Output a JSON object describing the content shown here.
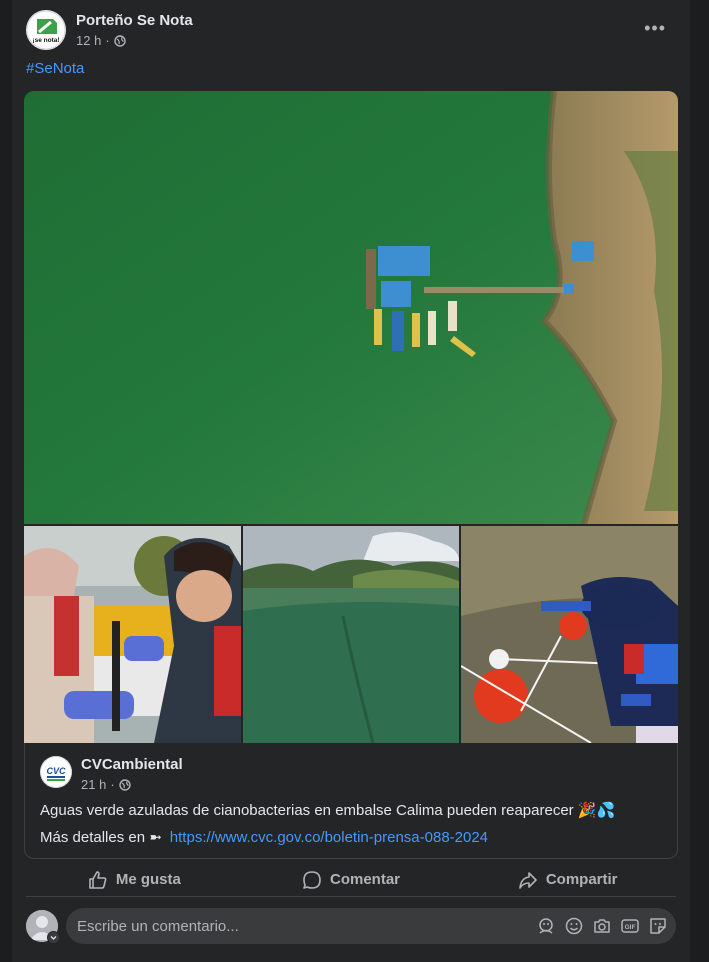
{
  "post": {
    "author": "Porteño Se Nota",
    "time": "12 h",
    "avatar_text": "¡se nota!",
    "hashtag": "#SeNota",
    "more_label": "•••"
  },
  "shared": {
    "author": "CVCambiental",
    "time": "21 h",
    "avatar_text": "CVC",
    "text": "Aguas verde azuladas de cianobacterias en embalse Calima pueden reaparecer 🎉💦",
    "more_prefix": "Más detalles en ➼",
    "link": "https://www.cvc.gov.co/boletin-prensa-088-2024"
  },
  "actions": {
    "like": "Me gusta",
    "comment": "Comentar",
    "share": "Compartir"
  },
  "comment_box": {
    "placeholder": "Escribe un comentario..."
  },
  "icons": {
    "audience": "globe-icon",
    "more": "more-dots-icon",
    "like": "thumbs-up-icon",
    "comment": "speech-bubble-icon",
    "share": "share-arrow-icon",
    "composer": [
      "avatar-sticker-icon",
      "smiley-icon",
      "camera-icon",
      "gif-icon",
      "sticker-icon"
    ]
  },
  "colors": {
    "background": "#242526",
    "link": "#4599ff",
    "text": "#e4e6eb",
    "secondary": "#b0b3b8"
  }
}
